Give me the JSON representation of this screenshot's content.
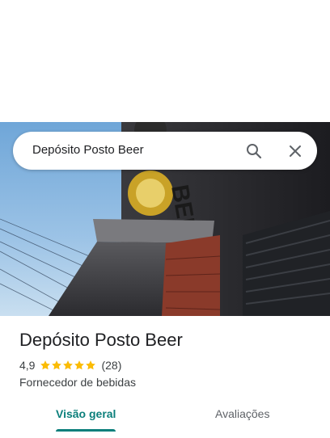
{
  "search": {
    "query": "Depósito Posto Beer",
    "search_icon": "search-icon",
    "close_icon": "close-icon"
  },
  "place": {
    "name": "Depósito Posto Beer",
    "rating": "4,9",
    "rating_value": 4.9,
    "reviews_count": "(28)",
    "category": "Fornecedor de bebidas"
  },
  "tabs": [
    {
      "label": "Visão geral",
      "active": true
    },
    {
      "label": "Avaliações",
      "active": false
    }
  ],
  "colors": {
    "accent": "#0b7f7b",
    "star": "#fbbc04"
  }
}
